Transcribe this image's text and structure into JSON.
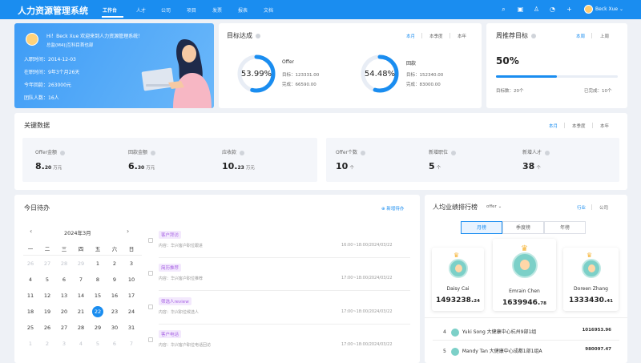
{
  "header": {
    "logo": "人力资源管理系统",
    "nav": [
      "工作台",
      "人才",
      "公司",
      "项目",
      "发票",
      "报表",
      "文档"
    ],
    "user": "Beck Xue"
  },
  "welcome": {
    "greeting": "Hi！Beck Xue 欢迎来到人力资源管理系统！",
    "role": "总监(M4)|互科目首也部",
    "join_date": "入职时间：2014-12-03",
    "tenure": "在职时间：9年3个月26天",
    "year_payment": "今年回款：263000元",
    "team": "团队人数：16人"
  },
  "goal": {
    "title": "目标达成",
    "tabs": [
      "本月",
      "本季度",
      "本年"
    ],
    "items": [
      {
        "pct_label": "53.99%",
        "pct": 53.99,
        "name": "Offer",
        "target": "目标：123331.00",
        "done": "完成：66590.00"
      },
      {
        "pct_label": "54.48%",
        "pct": 54.48,
        "name": "回款",
        "target": "目标：152340.00",
        "done": "完成：83000.00"
      }
    ]
  },
  "weekly": {
    "title": "周推荐目标",
    "tabs": [
      "本周",
      "上周"
    ],
    "pct_label": "50%",
    "pct": 50,
    "target": "目标数：20个",
    "done": "已完成：10个"
  },
  "key_data": {
    "title": "关键数据",
    "tabs": [
      "本月",
      "本季度",
      "本年"
    ],
    "items": [
      {
        "label": "Offer金额",
        "value": "8.",
        "decimal": "20",
        "unit": "万元"
      },
      {
        "label": "回款金额",
        "value": "6.",
        "decimal": "30",
        "unit": "万元"
      },
      {
        "label": "应收款",
        "value": "10.",
        "decimal": "23",
        "unit": "万元"
      },
      {
        "label": "Offer个数",
        "value": "10",
        "decimal": "",
        "unit": "个"
      },
      {
        "label": "新增职位",
        "value": "5",
        "decimal": "",
        "unit": "个"
      },
      {
        "label": "新增人才",
        "value": "38",
        "decimal": "",
        "unit": "个"
      }
    ]
  },
  "todo": {
    "title": "今日待办",
    "new_label": "新增待办",
    "month": "2024年3月",
    "weekdays": [
      "一",
      "二",
      "三",
      "四",
      "五",
      "六",
      "日"
    ],
    "days": [
      [
        "26",
        "27",
        "28",
        "29",
        "1",
        "2",
        "3"
      ],
      [
        "4",
        "5",
        "6",
        "7",
        "8",
        "9",
        "10"
      ],
      [
        "11",
        "12",
        "13",
        "14",
        "15",
        "16",
        "17"
      ],
      [
        "18",
        "19",
        "20",
        "21",
        "22",
        "23",
        "24"
      ],
      [
        "25",
        "26",
        "27",
        "28",
        "29",
        "30",
        "31"
      ],
      [
        "1",
        "2",
        "3",
        "4",
        "5",
        "6",
        "7"
      ]
    ],
    "items": [
      {
        "tag": "客户拜访",
        "content": "内容：华兴客户职位跟进",
        "time": "16:00~18:00/2024/03/22"
      },
      {
        "tag": "简历推荐",
        "content": "内容：华兴客户职位推荐",
        "time": "17:00~18:00/2024/03/22"
      },
      {
        "tag": "筛选人review",
        "content": "内容：华兴职位候选人",
        "time": "17:00~18:00/2024/03/22"
      },
      {
        "tag": "客户电话",
        "content": "内容：华兴客户职位电话回访",
        "time": "17:00~18:00/2024/03/22"
      }
    ]
  },
  "ranking": {
    "title": "人均业绩排行榜",
    "filter": "offer",
    "scope_tabs": [
      "行业",
      "公司"
    ],
    "tabs": [
      "月榜",
      "季度榜",
      "年榜"
    ],
    "podium": [
      {
        "name": "Daisy Cai",
        "score": "1493238.",
        "dec": "24"
      },
      {
        "name": "Emrain Chen",
        "score": "1639946.",
        "dec": "78"
      },
      {
        "name": "Doreen Zhang",
        "score": "1333430.",
        "dec": "41"
      }
    ],
    "list": [
      {
        "rank": "4",
        "name": "Yuki Song",
        "dept": "大健康中心杭州9部1组",
        "score": "1016953.96"
      },
      {
        "rank": "5",
        "name": "Mandy Tan",
        "dept": "大健康中心成都1部1组A",
        "score": "980097.47"
      }
    ]
  },
  "colors": {
    "primary": "#1a8df0",
    "purple_tag": "#a864e4"
  }
}
